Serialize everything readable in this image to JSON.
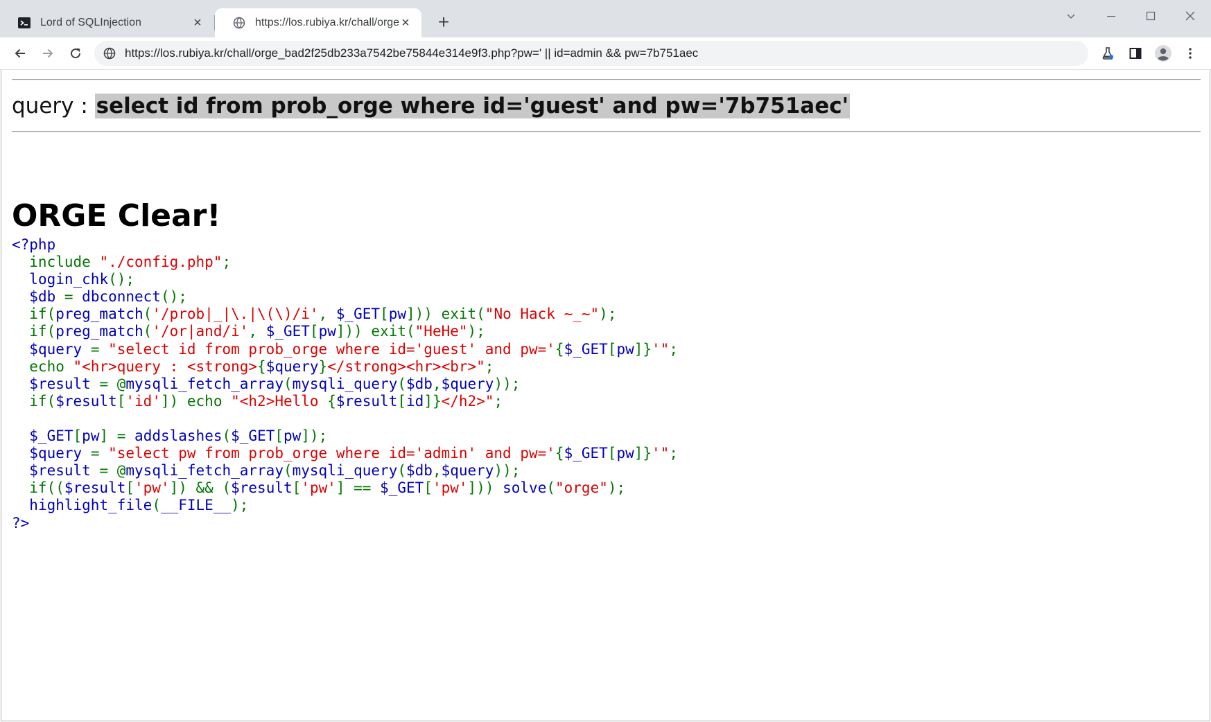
{
  "browser": {
    "tabs": [
      {
        "title": "Lord of SQLInjection",
        "active": false,
        "icon": "terminal-icon"
      },
      {
        "title": "https://los.rubiya.kr/chall/orge_b",
        "active": true,
        "icon": "globe-icon"
      }
    ],
    "new_tab_label": "+",
    "url": "https://los.rubiya.kr/chall/orge_bad2f25db233a7542be75844e314e9f3.php?pw=' || id=admin && pw=7b751aec"
  },
  "page": {
    "query_label": "query : ",
    "query_text": "select id from prob_orge where id='guest' and pw='7b751aec'",
    "clear_heading": "ORGE Clear!"
  },
  "code": {
    "colors": {
      "default": "#0000bb",
      "keyword": "#007700",
      "string": "#dd0000"
    },
    "lines": [
      [
        [
          "d",
          "<?php"
        ]
      ],
      [
        [
          "k",
          "  include "
        ],
        [
          "s",
          "\"./config.php\""
        ],
        [
          "k",
          ";"
        ]
      ],
      [
        [
          "k",
          "  "
        ],
        [
          "d",
          "login_chk"
        ],
        [
          "k",
          "();"
        ]
      ],
      [
        [
          "k",
          "  "
        ],
        [
          "d",
          "$db "
        ],
        [
          "k",
          "= "
        ],
        [
          "d",
          "dbconnect"
        ],
        [
          "k",
          "();"
        ]
      ],
      [
        [
          "k",
          "  if("
        ],
        [
          "d",
          "preg_match"
        ],
        [
          "k",
          "("
        ],
        [
          "s",
          "'/prob|_|\\.|\\(\\)/i'"
        ],
        [
          "k",
          ", "
        ],
        [
          "d",
          "$_GET"
        ],
        [
          "k",
          "["
        ],
        [
          "d",
          "pw"
        ],
        [
          "k",
          "])) exit("
        ],
        [
          "s",
          "\"No Hack ~_~\""
        ],
        [
          "k",
          ");"
        ]
      ],
      [
        [
          "k",
          "  if("
        ],
        [
          "d",
          "preg_match"
        ],
        [
          "k",
          "("
        ],
        [
          "s",
          "'/or|and/i'"
        ],
        [
          "k",
          ", "
        ],
        [
          "d",
          "$_GET"
        ],
        [
          "k",
          "["
        ],
        [
          "d",
          "pw"
        ],
        [
          "k",
          "])) exit("
        ],
        [
          "s",
          "\"HeHe\""
        ],
        [
          "k",
          ");"
        ]
      ],
      [
        [
          "k",
          "  "
        ],
        [
          "d",
          "$query "
        ],
        [
          "k",
          "= "
        ],
        [
          "s",
          "\"select id from prob_orge where id='guest' and pw='"
        ],
        [
          "k",
          "{"
        ],
        [
          "d",
          "$_GET"
        ],
        [
          "k",
          "["
        ],
        [
          "d",
          "pw"
        ],
        [
          "k",
          "]}"
        ],
        [
          "s",
          "'\""
        ],
        [
          "k",
          ";"
        ]
      ],
      [
        [
          "k",
          "  echo "
        ],
        [
          "s",
          "\"<hr>query : <strong>"
        ],
        [
          "k",
          "{"
        ],
        [
          "d",
          "$query"
        ],
        [
          "k",
          "}"
        ],
        [
          "s",
          "</strong><hr><br>\""
        ],
        [
          "k",
          ";"
        ]
      ],
      [
        [
          "k",
          "  "
        ],
        [
          "d",
          "$result "
        ],
        [
          "k",
          "= @"
        ],
        [
          "d",
          "mysqli_fetch_array"
        ],
        [
          "k",
          "("
        ],
        [
          "d",
          "mysqli_query"
        ],
        [
          "k",
          "("
        ],
        [
          "d",
          "$db"
        ],
        [
          "k",
          ","
        ],
        [
          "d",
          "$query"
        ],
        [
          "k",
          "));"
        ]
      ],
      [
        [
          "k",
          "  if("
        ],
        [
          "d",
          "$result"
        ],
        [
          "k",
          "["
        ],
        [
          "s",
          "'id'"
        ],
        [
          "k",
          "]) echo "
        ],
        [
          "s",
          "\"<h2>Hello "
        ],
        [
          "k",
          "{"
        ],
        [
          "d",
          "$result"
        ],
        [
          "k",
          "["
        ],
        [
          "d",
          "id"
        ],
        [
          "k",
          "]}"
        ],
        [
          "s",
          "</h2>\""
        ],
        [
          "k",
          ";"
        ]
      ],
      [
        [
          "k",
          " "
        ]
      ],
      [
        [
          "k",
          "  "
        ],
        [
          "d",
          "$_GET"
        ],
        [
          "k",
          "["
        ],
        [
          "d",
          "pw"
        ],
        [
          "k",
          "] = "
        ],
        [
          "d",
          "addslashes"
        ],
        [
          "k",
          "("
        ],
        [
          "d",
          "$_GET"
        ],
        [
          "k",
          "["
        ],
        [
          "d",
          "pw"
        ],
        [
          "k",
          "]);"
        ]
      ],
      [
        [
          "k",
          "  "
        ],
        [
          "d",
          "$query "
        ],
        [
          "k",
          "= "
        ],
        [
          "s",
          "\"select pw from prob_orge where id='admin' and pw='"
        ],
        [
          "k",
          "{"
        ],
        [
          "d",
          "$_GET"
        ],
        [
          "k",
          "["
        ],
        [
          "d",
          "pw"
        ],
        [
          "k",
          "]}"
        ],
        [
          "s",
          "'\""
        ],
        [
          "k",
          ";"
        ]
      ],
      [
        [
          "k",
          "  "
        ],
        [
          "d",
          "$result "
        ],
        [
          "k",
          "= @"
        ],
        [
          "d",
          "mysqli_fetch_array"
        ],
        [
          "k",
          "("
        ],
        [
          "d",
          "mysqli_query"
        ],
        [
          "k",
          "("
        ],
        [
          "d",
          "$db"
        ],
        [
          "k",
          ","
        ],
        [
          "d",
          "$query"
        ],
        [
          "k",
          "));"
        ]
      ],
      [
        [
          "k",
          "  if(("
        ],
        [
          "d",
          "$result"
        ],
        [
          "k",
          "["
        ],
        [
          "s",
          "'pw'"
        ],
        [
          "k",
          "]) && ("
        ],
        [
          "d",
          "$result"
        ],
        [
          "k",
          "["
        ],
        [
          "s",
          "'pw'"
        ],
        [
          "k",
          "] == "
        ],
        [
          "d",
          "$_GET"
        ],
        [
          "k",
          "["
        ],
        [
          "s",
          "'pw'"
        ],
        [
          "k",
          "])) "
        ],
        [
          "d",
          "solve"
        ],
        [
          "k",
          "("
        ],
        [
          "s",
          "\"orge\""
        ],
        [
          "k",
          ");"
        ]
      ],
      [
        [
          "k",
          "  "
        ],
        [
          "d",
          "highlight_file"
        ],
        [
          "k",
          "("
        ],
        [
          "d",
          "__FILE__"
        ],
        [
          "k",
          ");"
        ]
      ],
      [
        [
          "d",
          "?>"
        ]
      ]
    ]
  }
}
